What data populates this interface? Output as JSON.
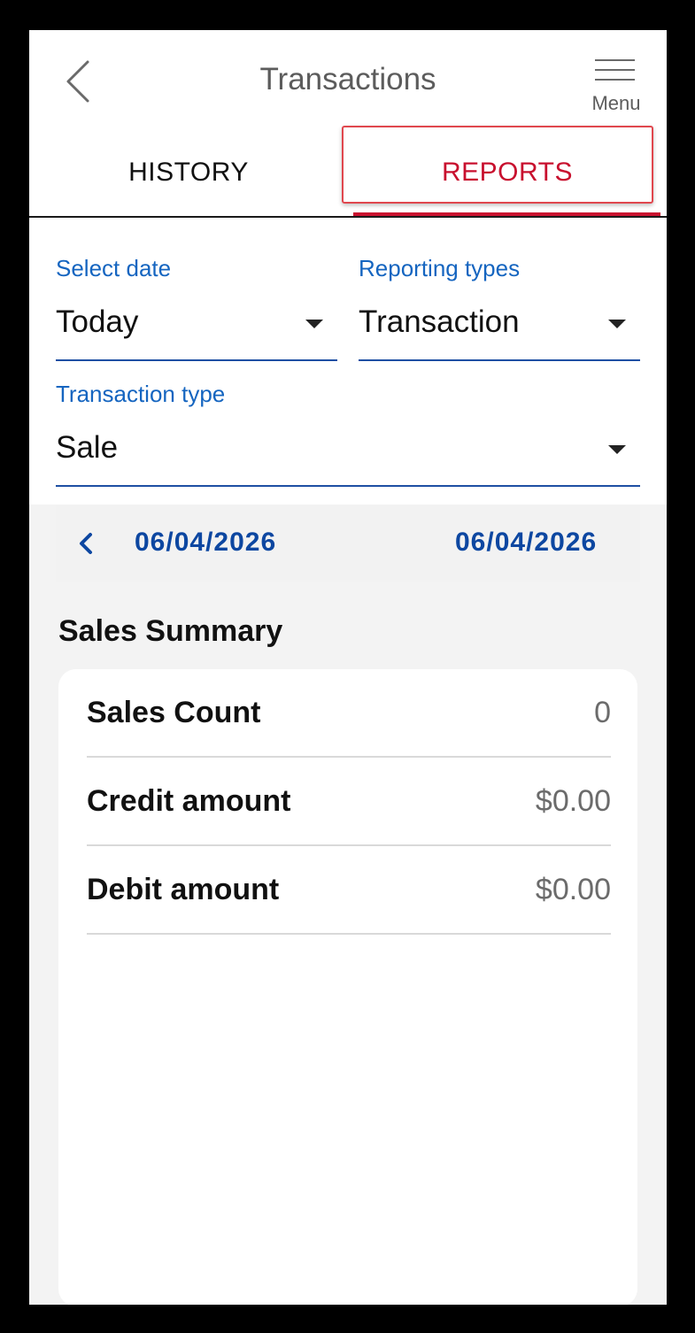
{
  "header": {
    "title": "Transactions",
    "menu_label": "Menu",
    "back_icon": "chevron-left-icon",
    "menu_icon": "hamburger-icon"
  },
  "tabs": [
    {
      "label": "HISTORY",
      "active": false
    },
    {
      "label": "REPORTS",
      "active": true
    }
  ],
  "filters": {
    "select_date": {
      "label": "Select date",
      "value": "Today"
    },
    "reporting_types": {
      "label": "Reporting types",
      "value": "Transaction"
    },
    "transaction_type": {
      "label": "Transaction type",
      "value": "Sale"
    }
  },
  "date_range": {
    "start": "06/04/2026",
    "end": "06/04/2026"
  },
  "summary": {
    "title": "Sales Summary",
    "rows": [
      {
        "label": "Sales Count",
        "value": "0"
      },
      {
        "label": "Credit amount",
        "value": "$0.00"
      },
      {
        "label": "Debit amount",
        "value": "$0.00"
      }
    ]
  },
  "colors": {
    "accent_red": "#c8102e",
    "link_blue": "#0d47a1",
    "field_label_blue": "#1565c0"
  }
}
